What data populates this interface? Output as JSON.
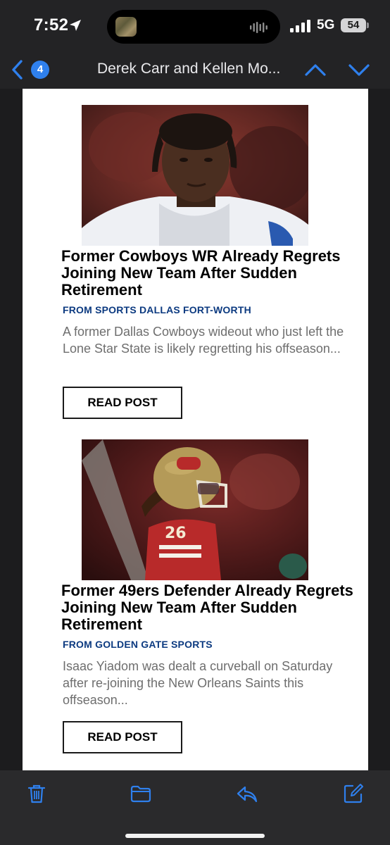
{
  "status_bar": {
    "time": "7:52",
    "network": "5G",
    "battery": "54"
  },
  "nav": {
    "unread_count": "4",
    "title": "Derek Carr and Kellen Mo..."
  },
  "articles": [
    {
      "headline": "Former Cowboys WR Already Regrets Joining New Team After Sudden Retirement",
      "source": "FROM SPORTS DALLAS FORT-WORTH",
      "snippet": "A former Dallas Cowboys wideout who just left the Lone Star State is likely regretting his offseason...",
      "button": "READ POST"
    },
    {
      "headline": "Former 49ers Defender Already Regrets Joining New Team After Sudden Retirement",
      "source": "FROM GOLDEN GATE SPORTS",
      "snippet": "Isaac Yiadom was dealt a curveball on Saturday after re-joining the New Orleans Saints this offseason...",
      "button": "READ POST"
    }
  ],
  "toolbar": {
    "icons": [
      "trash-icon",
      "folder-icon",
      "reply-icon",
      "compose-icon"
    ]
  },
  "colors": {
    "accent": "#2f80ed",
    "source_link": "#0c3a80",
    "chrome_bg": "#232325"
  }
}
